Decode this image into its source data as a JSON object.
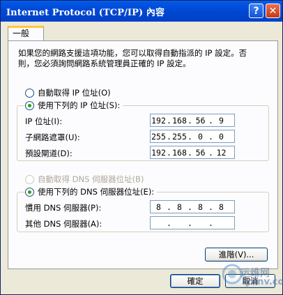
{
  "window": {
    "title": "Internet Protocol (TCP/IP) 內容",
    "help_glyph": "?",
    "close_glyph": "✕"
  },
  "tab": {
    "label": "一般"
  },
  "intro_text": "如果您的網路支援這項功能，您可以取得自動指派的 IP 設定。否\n則，您必須詢問網路系統管理員正確的 IP 設定。",
  "ip": {
    "auto_label": "自動取得 IP 位址(O)",
    "manual_label": "使用下列的 IP 位址(S):",
    "selected": "manual",
    "fields": [
      {
        "label": "IP 位址(I):",
        "value": [
          "192",
          "168",
          "56",
          "9"
        ]
      },
      {
        "label": "子網路遮罩(U):",
        "value": [
          "255",
          "255",
          "0",
          "0"
        ]
      },
      {
        "label": "預設閘道(D):",
        "value": [
          "192",
          "168",
          "56",
          "12"
        ]
      }
    ]
  },
  "dns": {
    "auto_label": "自動取得 DNS 伺服器位址(B)",
    "manual_label": "使用下列的 DNS 伺服器位址(E):",
    "selected": "manual",
    "fields": [
      {
        "label": "慣用 DNS 伺服器(P):",
        "value": [
          "8",
          "8",
          "8",
          "8"
        ]
      },
      {
        "label": "其他 DNS 伺服器(A):",
        "value": [
          "",
          "",
          "",
          ""
        ]
      }
    ]
  },
  "buttons": {
    "advanced": "進階(V)...",
    "ok": "確定",
    "cancel": "取消"
  },
  "watermark": {
    "text": "运维网",
    "sub": "iyunv.com"
  },
  "colors": {
    "title_bar": "#0146D0",
    "face": "#ECE9D8",
    "radio_dot": "#21A121"
  }
}
